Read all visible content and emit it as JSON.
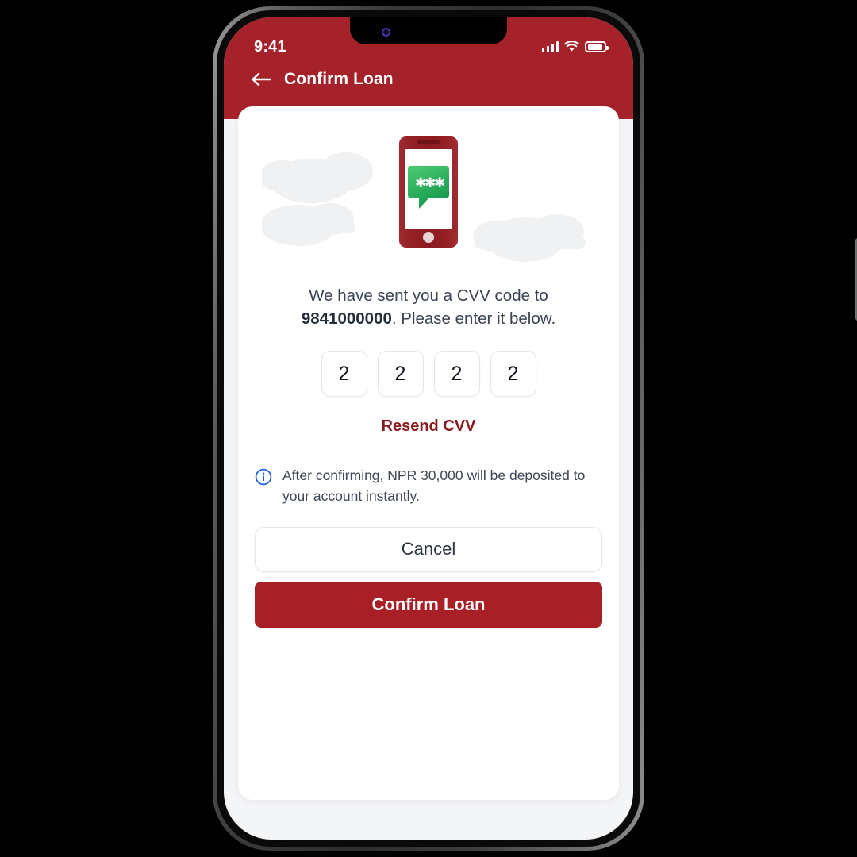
{
  "status_bar": {
    "time": "9:41",
    "signal_icon": "signal-bars-icon",
    "wifi_icon": "wifi-icon",
    "battery_icon": "battery-icon"
  },
  "header": {
    "back_icon": "back-arrow-icon",
    "title": "Confirm Loan",
    "background_color": "#A6222A"
  },
  "illustration": {
    "name": "phone-sms-otp-illustration",
    "phone_color": "#8E1B20",
    "bubble_color_start": "#4CC66E",
    "bubble_color_end": "#179B4E",
    "bubble_text": "✱ ✱ ✱",
    "cloud_color": "#F0F1F2"
  },
  "message": {
    "line1": "We have sent you a CVV code to",
    "phone_number": "9841000000",
    "line2": ". Please enter it below."
  },
  "otp": {
    "digits": [
      "2",
      "2",
      "2",
      "2"
    ],
    "border_color": "#E3E5EA"
  },
  "resend": {
    "label": "Resend CVV",
    "color": "#8B1A1F"
  },
  "info": {
    "icon": "info-circle-icon",
    "icon_color": "#1B60E0",
    "text": "After confirming, NPR 30,000 will be deposited to your account instantly."
  },
  "actions": {
    "cancel_label": "Cancel",
    "confirm_label": "Confirm Loan",
    "confirm_color": "#A81F26"
  }
}
